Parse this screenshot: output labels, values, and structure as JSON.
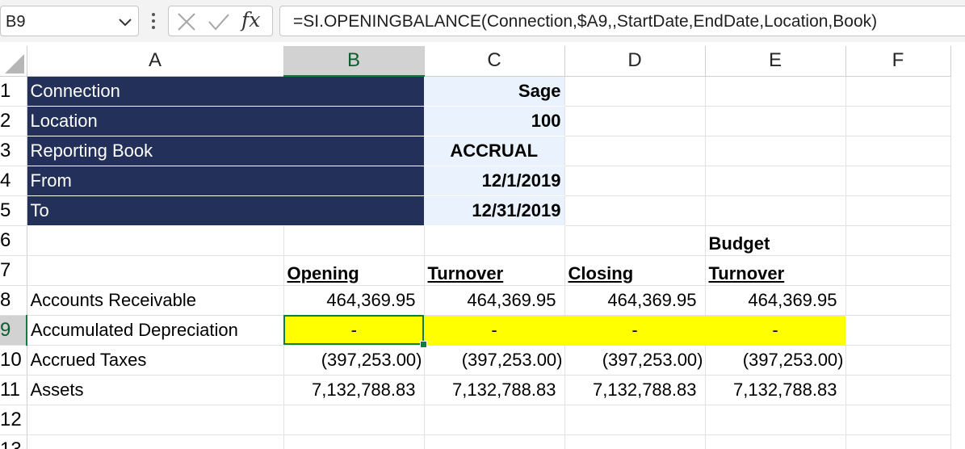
{
  "formula_bar": {
    "name_box": "B9",
    "fx_label": "fx",
    "formula": "=SI.OPENINGBALANCE(Connection,$A9,,StartDate,EndDate,Location,Book)"
  },
  "columns": [
    "A",
    "B",
    "C",
    "D",
    "E",
    "F"
  ],
  "selected_column": "B",
  "rows": [
    "1",
    "2",
    "3",
    "4",
    "5",
    "6",
    "7",
    "8",
    "9",
    "10",
    "11",
    "12",
    "13"
  ],
  "selected_row": "9",
  "params": [
    {
      "label": "Connection",
      "value": "Sage"
    },
    {
      "label": "Location",
      "value": "100"
    },
    {
      "label": "Reporting Book",
      "value": "ACCRUAL"
    },
    {
      "label": "From",
      "value": "12/1/2019"
    },
    {
      "label": "To",
      "value": "12/31/2019"
    }
  ],
  "headers": {
    "budget_line1": "Budget",
    "opening": "Opening",
    "turnover": "Turnover",
    "closing": "Closing",
    "budget_turnover": "Turnover"
  },
  "data_rows": [
    {
      "account": "Accounts Receivable",
      "opening": "464,369.95",
      "turnover": "464,369.95",
      "closing": "464,369.95",
      "budget": "464,369.95"
    },
    {
      "account": "Accumulated Depreciation",
      "opening": "-",
      "turnover": "-",
      "closing": "-",
      "budget": "-"
    },
    {
      "account": "Accrued Taxes",
      "opening": "(397,253.00)",
      "turnover": "(397,253.00)",
      "closing": "(397,253.00)",
      "budget": "(397,253.00)"
    },
    {
      "account": "Assets",
      "opening": "7,132,788.83",
      "turnover": "7,132,788.83",
      "closing": "7,132,788.83",
      "budget": "7,132,788.83"
    }
  ],
  "colors": {
    "navy_fill": "#233059",
    "light_fill": "#eaf2fd",
    "highlight": "#ffff00",
    "selection": "#107c41"
  }
}
